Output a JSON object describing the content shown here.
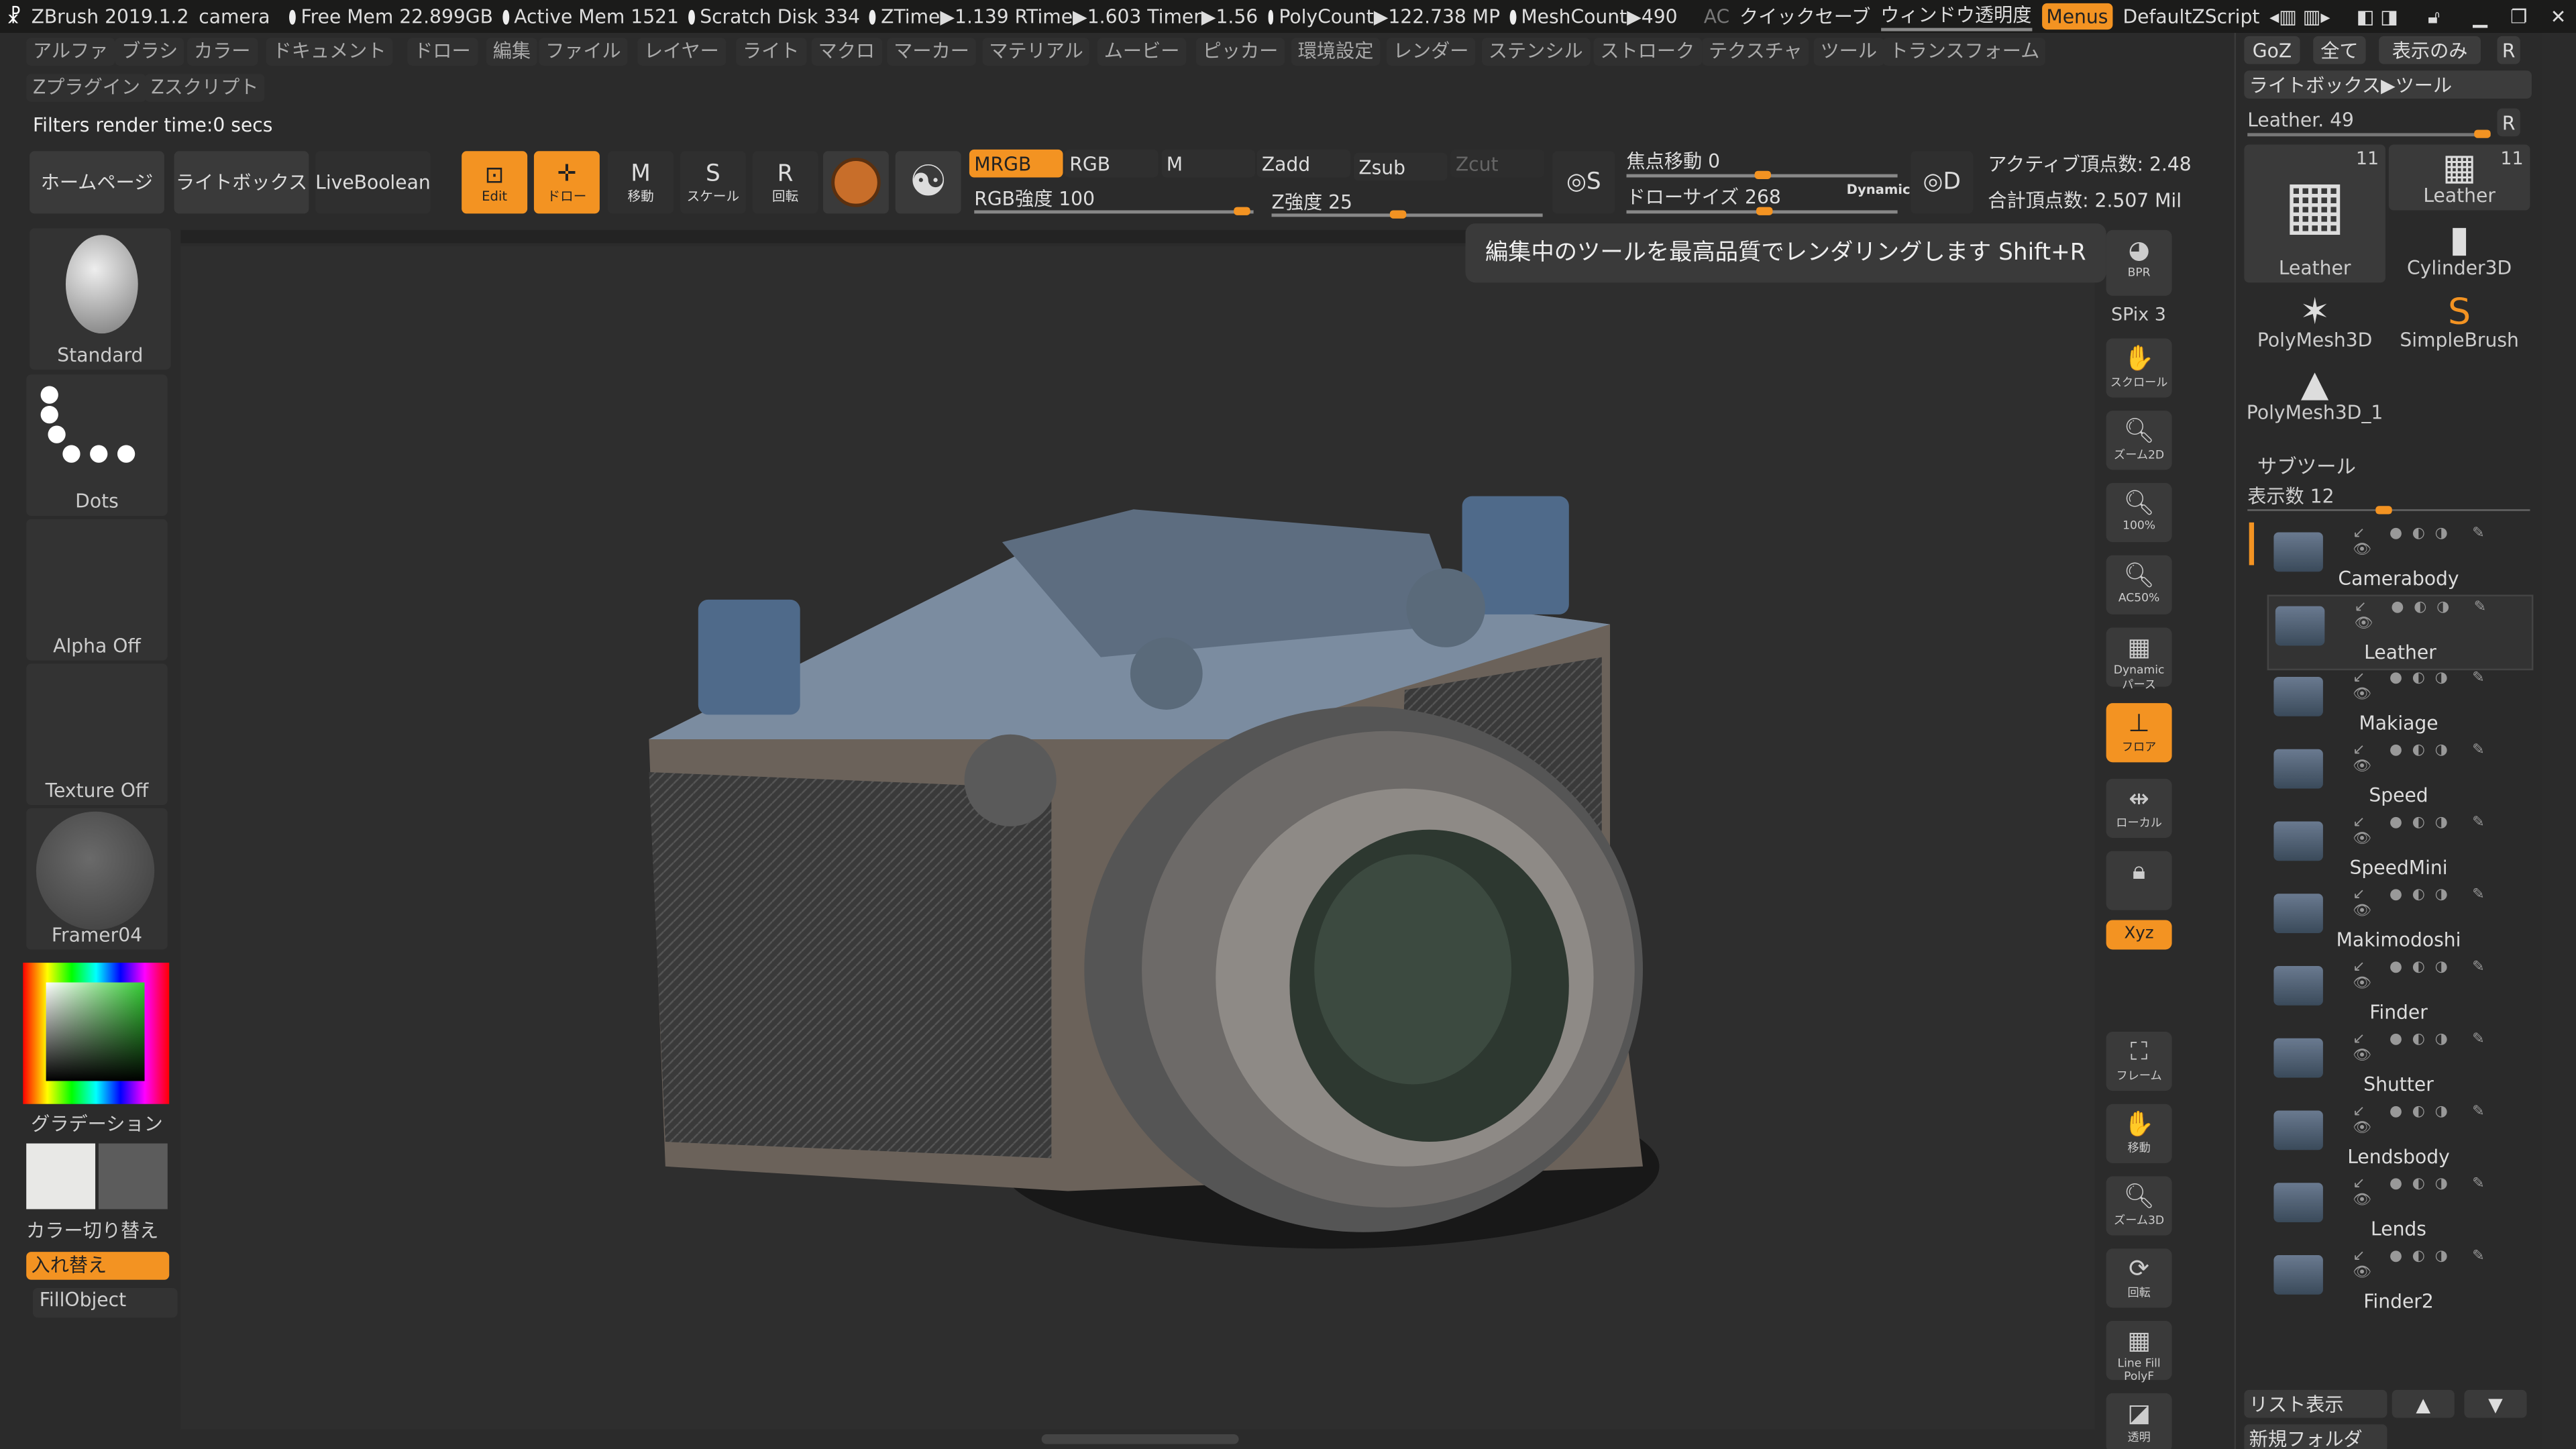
{
  "titlebar": {
    "app": "ZBrush 2019.1.2",
    "doc": "camera",
    "free_mem": "Free Mem 22.899GB",
    "active_mem": "Active Mem 1521",
    "scratch": "Scratch Disk 334",
    "ztime": "ZTime▶1.139 RTime▶1.603 Timer▶1.56",
    "polycount": "PolyCount▶122.738 MP",
    "meshcount": "MeshCount▶490",
    "ac": "AC",
    "quicksave": "クイックセーブ",
    "transparency": "ウィンドウ透明度",
    "menus": "Menus",
    "script": "DefaultZScript"
  },
  "menu": [
    "アルファ",
    "ブラシ",
    "カラー",
    "ドキュメント",
    "ドロー",
    "編集",
    "ファイル",
    "レイヤー",
    "ライト",
    "マクロ",
    "マーカー",
    "マテリアル",
    "ムービー",
    "ピッカー",
    "環境設定",
    "レンダー",
    "ステンシル",
    "ストローク",
    "テクスチャ",
    "ツール",
    "トランスフォーム"
  ],
  "menu2": [
    "Zプラグイン",
    "Zスクリプト"
  ],
  "status": "Filters render time:0 secs",
  "toolbar": {
    "home": "ホームページ",
    "lightbox": "ライトボックス",
    "liveboolean": "LiveBoolean",
    "edit": "Edit",
    "draw": "ドロー",
    "move": "移動",
    "scale": "スケール",
    "rotate": "回転",
    "mrgb": "MRGB",
    "rgb": "RGB",
    "m": "M",
    "zadd": "Zadd",
    "zsub": "Zsub",
    "zcut": "Zcut",
    "rgb_intensity": "RGB強度 100",
    "z_intensity": "Z強度 25",
    "focal": "焦点移動 0",
    "drawsize": "ドローサイズ 268",
    "dynamic": "Dynamic",
    "active_points": "アクティブ頂点数: 2.48",
    "total_points": "合計頂点数: 2.507 Mil",
    "rgb_intensity_value": 100,
    "z_intensity_value": 25,
    "focal_value": 0,
    "drawsize_value": 268
  },
  "tooltip": "編集中のツールを最高品質でレンダリングします Shift+R",
  "left": {
    "brush": "Standard",
    "stroke": "Dots",
    "alpha": "Alpha Off",
    "texture": "Texture Off",
    "material": "Framer04",
    "gradient": "グラデーション",
    "switch": "カラー切り替え",
    "swap": "入れ替え",
    "fill": "FillObject"
  },
  "shelf": {
    "bpr": "BPR",
    "spix": "SPix 3",
    "scroll": "スクロール",
    "zoom2d": "ズーム2D",
    "pct100": "100%",
    "ac50": "AC50%",
    "persp": "Dynamic パース",
    "floor": "フロア",
    "local": "ローカル",
    "xyz": "Xyz",
    "frame": "フレーム",
    "move": "移動",
    "zoom3d": "ズーム3D",
    "rotate": "回転",
    "polyf": "Line Fill PolyF",
    "transp": "透明"
  },
  "tool": {
    "goz": "GoZ",
    "all": "全て",
    "visible": "表示のみ",
    "r": "R",
    "lightbox_tool": "ライトボックス▶ツール",
    "current": "Leather. 49",
    "thumbs": [
      {
        "name": "Leather",
        "count": "11"
      },
      {
        "name": "Leather",
        "count": "11"
      },
      {
        "name": "Cylinder3D"
      },
      {
        "name": "PolyMesh3D"
      },
      {
        "name": "SimpleBrush"
      },
      {
        "name": "PolyMesh3D_1"
      }
    ]
  },
  "subtool": {
    "title": "サブツール",
    "count": "表示数 12",
    "items": [
      "Camerabody",
      "Leather",
      "Makiage",
      "Speed",
      "SpeedMini",
      "Makimodoshi",
      "Finder",
      "Shutter",
      "Lendsbody",
      "Lends",
      "Finder2"
    ],
    "list": "リスト表示",
    "newfolder": "新規フォルダ"
  },
  "colors": {
    "accent": "#f39322",
    "bg": "#2b2b2b"
  }
}
